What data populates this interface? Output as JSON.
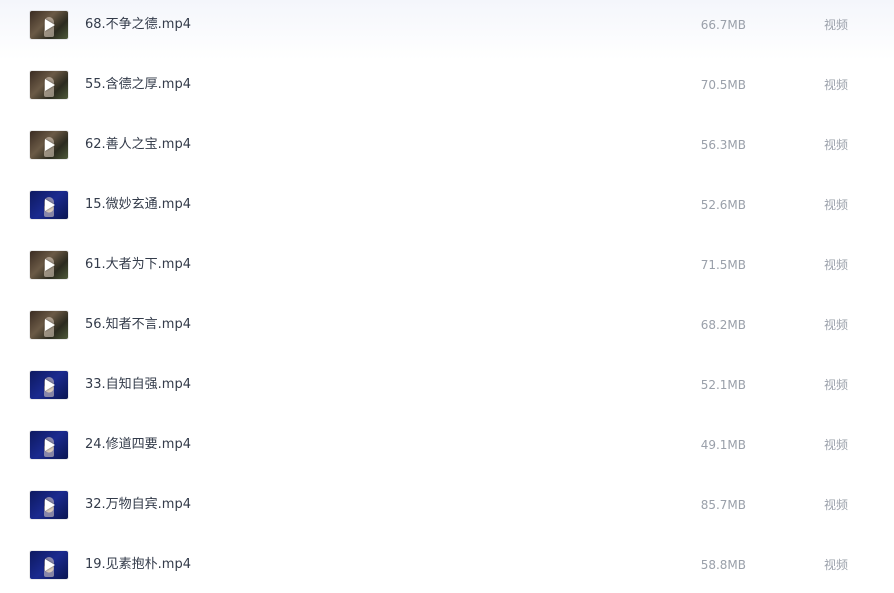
{
  "files": [
    {
      "name": "68.不争之德.mp4",
      "size": "66.7MB",
      "type": "视频",
      "thumb": "warm"
    },
    {
      "name": "55.含德之厚.mp4",
      "size": "70.5MB",
      "type": "视频",
      "thumb": "warm"
    },
    {
      "name": "62.善人之宝.mp4",
      "size": "56.3MB",
      "type": "视频",
      "thumb": "warm"
    },
    {
      "name": "15.微妙玄通.mp4",
      "size": "52.6MB",
      "type": "视频",
      "thumb": "blue"
    },
    {
      "name": "61.大者为下.mp4",
      "size": "71.5MB",
      "type": "视频",
      "thumb": "warm"
    },
    {
      "name": "56.知者不言.mp4",
      "size": "68.2MB",
      "type": "视频",
      "thumb": "warm"
    },
    {
      "name": "33.自知自强.mp4",
      "size": "52.1MB",
      "type": "视频",
      "thumb": "blue"
    },
    {
      "name": "24.修道四要.mp4",
      "size": "49.1MB",
      "type": "视频",
      "thumb": "blue"
    },
    {
      "name": "32.万物自宾.mp4",
      "size": "85.7MB",
      "type": "视频",
      "thumb": "blue"
    },
    {
      "name": "19.见素抱朴.mp4",
      "size": "58.8MB",
      "type": "视频",
      "thumb": "blue"
    }
  ]
}
